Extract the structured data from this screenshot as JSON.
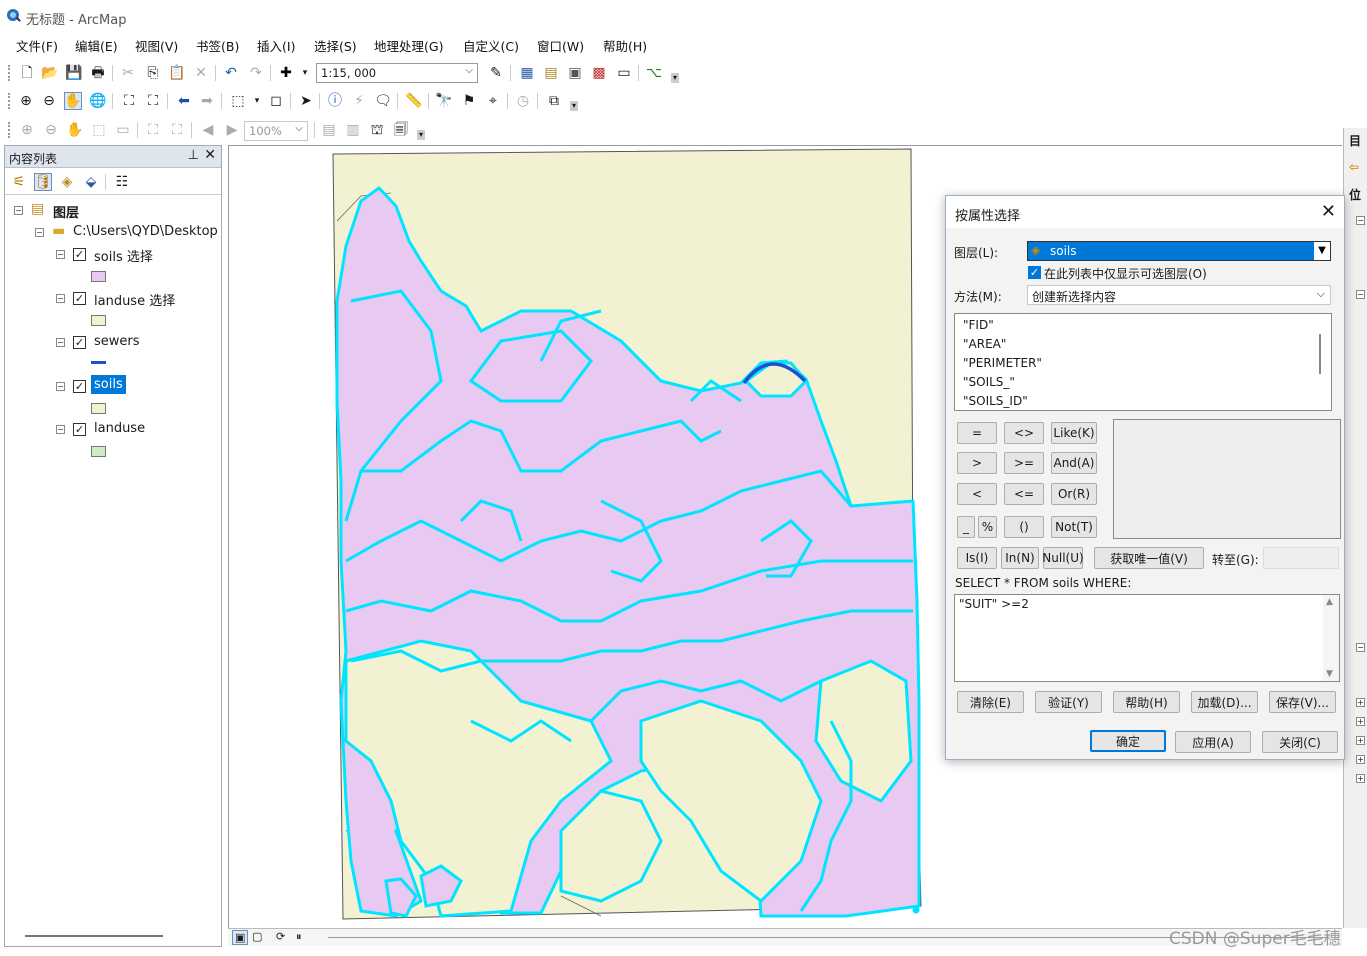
{
  "window": {
    "title": "无标题 - ArcMap"
  },
  "menu": [
    "文件(F)",
    "编辑(E)",
    "视图(V)",
    "书签(B)",
    "插入(I)",
    "选择(S)",
    "地理处理(G)",
    "自定义(C)",
    "窗口(W)",
    "帮助(H)"
  ],
  "toolbar": {
    "scale": "1:15, 000",
    "zoom": "100%"
  },
  "toc": {
    "title": "内容列表",
    "root": "图层",
    "folder": "C:\\Users\\QYD\\Desktop",
    "layers": [
      {
        "label": "soils 选择",
        "checked": true,
        "swatch": "#e8c9f2"
      },
      {
        "label": "landuse 选择",
        "checked": true,
        "swatch": "#f2f2cf"
      },
      {
        "label": "sewers",
        "checked": true,
        "swatch": "#1f4fd1"
      },
      {
        "label": "soils",
        "checked": true,
        "swatch": "#f2f2cf",
        "selected": true
      },
      {
        "label": "landuse",
        "checked": true,
        "swatch": "#cdebc5"
      }
    ]
  },
  "dialog": {
    "title": "按属性选择",
    "layer_label": "图层(L):",
    "layer_value": "soils",
    "only_selectable": "在此列表中仅显示可选图层(O)",
    "method_label": "方法(M):",
    "method_value": "创建新选择内容",
    "fields": [
      "\"FID\"",
      "\"AREA\"",
      "\"PERIMETER\"",
      "\"SOILS_\"",
      "\"SOILS_ID\""
    ],
    "operators": [
      [
        "=",
        "<>",
        "Like(K)"
      ],
      [
        ">",
        ">=",
        "And(A)"
      ],
      [
        "<",
        "<=",
        "Or(R)"
      ],
      [
        "_",
        "%",
        "()",
        "Not(T)"
      ]
    ],
    "extra_ops": [
      "Is(I)",
      "In(N)",
      "Null(U)"
    ],
    "unique_values": "获取唯一值(V)",
    "goto": "转至(G):",
    "sql_prefix": "SELECT * FROM soils WHERE:",
    "expression": "\"SUIT\" >=2",
    "actions": [
      "清除(E)",
      "验证(Y)",
      "帮助(H)",
      "加载(D)...",
      "保存(V)..."
    ],
    "ok": "确定",
    "apply": "应用(A)",
    "close": "关闭(C)"
  },
  "right_panel": {
    "label1": "目",
    "label2": "位"
  },
  "watermark": "CSDN @Super毛毛穗",
  "colors": {
    "selected_fill": "#e8c9f2",
    "landuse_fill": "#f2f2d2",
    "outline": "#00e5ff",
    "sewer": "#1f4fd1",
    "highlight": "#0078d7"
  }
}
